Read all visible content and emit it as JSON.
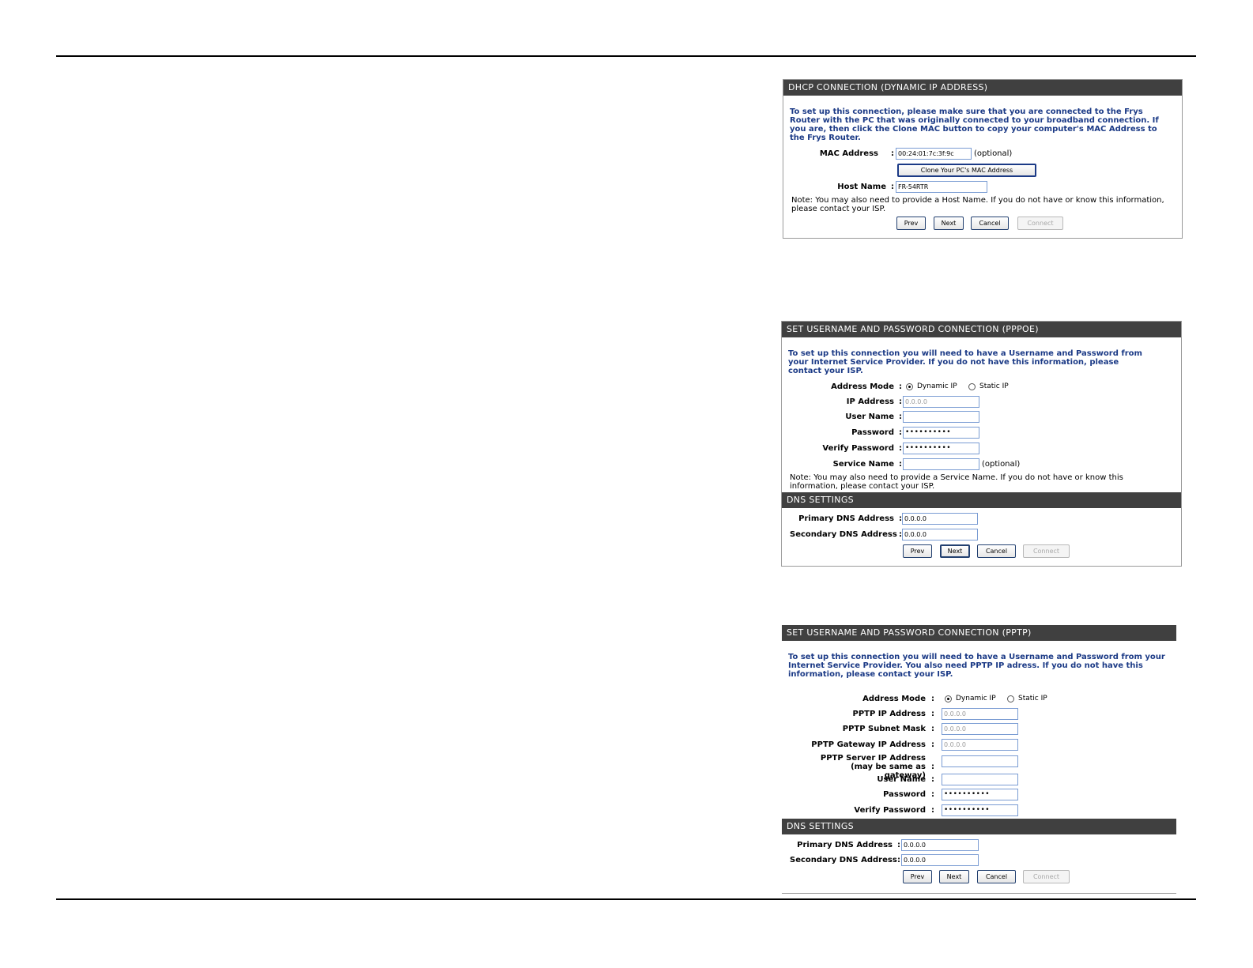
{
  "dhcp": {
    "header": "DHCP CONNECTION (DYNAMIC IP ADDRESS)",
    "intro": "To set up this connection, please make sure that you are connected to the Frys Router with the PC that was originally connected to your broadband connection. If you are, then click the Clone MAC button to copy your computer's MAC Address to the Frys Router.",
    "mac_label": "MAC Address",
    "mac_value": "00:24:01:7c:3f:9c",
    "optional": "(optional)",
    "clone_button": "Clone Your PC's MAC Address",
    "host_label": "Host Name",
    "host_value": "FR-54RTR",
    "note": "Note: You may also need to provide a Host Name. If you do not have or know this information, please contact your ISP.",
    "buttons": {
      "prev": "Prev",
      "next": "Next",
      "cancel": "Cancel",
      "connect": "Connect"
    }
  },
  "pppoe": {
    "header": "SET USERNAME AND PASSWORD CONNECTION (PPPOE)",
    "intro": "To set up this connection you will need to have a Username and Password from your Internet Service Provider. If you do not have this information, please contact your ISP.",
    "address_mode_label": "Address Mode",
    "dynamic_ip": "Dynamic IP",
    "static_ip": "Static IP",
    "ip_label": "IP Address",
    "ip_value": "0.0.0.0",
    "user_label": "User Name",
    "user_value": "",
    "password_label": "Password",
    "password_value": "••••••••••",
    "verify_label": "Verify Password",
    "verify_value": "••••••••••",
    "service_label": "Service Name",
    "service_value": "",
    "optional": "(optional)",
    "note": "Note: You may also need to provide a Service Name. If you do not have or know this information, please contact your ISP.",
    "dns_header": "DNS SETTINGS",
    "primary_dns_label": "Primary DNS Address",
    "primary_dns_value": "0.0.0.0",
    "secondary_dns_label": "Secondary DNS Address",
    "secondary_dns_value": "0.0.0.0",
    "buttons": {
      "prev": "Prev",
      "next": "Next",
      "cancel": "Cancel",
      "connect": "Connect"
    }
  },
  "pptp": {
    "header": "SET USERNAME AND PASSWORD CONNECTION (PPTP)",
    "intro": "To set up this connection you will need to have a Username and Password from your Internet Service Provider. You also need PPTP IP adress. If you do not have this information, please contact your ISP.",
    "address_mode_label": "Address Mode",
    "dynamic_ip": "Dynamic IP",
    "static_ip": "Static IP",
    "ip_label": "PPTP IP Address",
    "ip_value": "0.0.0.0",
    "subnet_label": "PPTP Subnet Mask",
    "subnet_value": "0.0.0.0",
    "gateway_label": "PPTP Gateway IP Address",
    "gateway_value": "0.0.0.0",
    "server_label": "PPTP Server IP Address (may be same as gateway)",
    "server_value": "",
    "user_label": "User Name",
    "user_value": "",
    "password_label": "Password",
    "password_value": "••••••••••",
    "verify_label": "Verify Password",
    "verify_value": "••••••••••",
    "dns_header": "DNS SETTINGS",
    "primary_dns_label": "Primary DNS Address",
    "primary_dns_value": "0.0.0.0",
    "secondary_dns_label": "Secondary DNS Address",
    "secondary_dns_value": "0.0.0.0",
    "buttons": {
      "prev": "Prev",
      "next": "Next",
      "cancel": "Cancel",
      "connect": "Connect"
    }
  }
}
